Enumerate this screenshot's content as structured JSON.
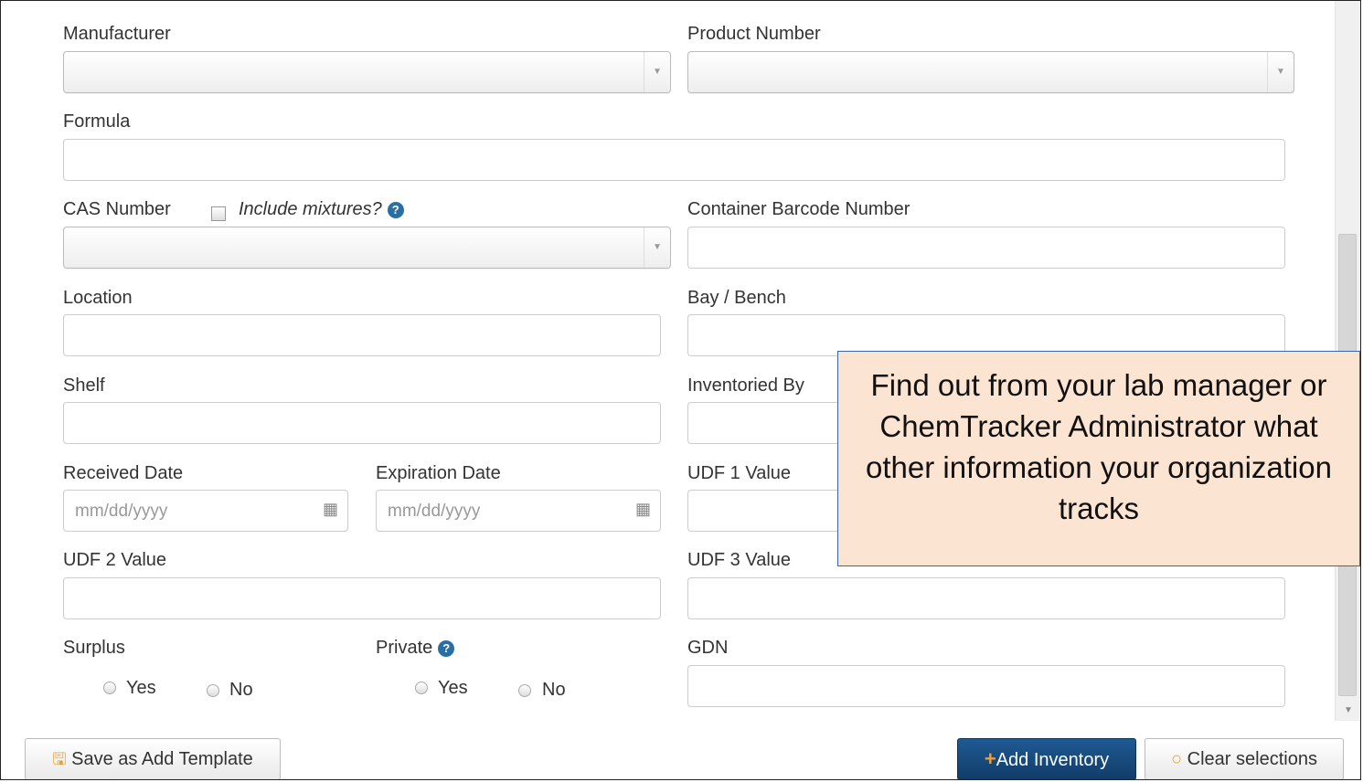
{
  "form": {
    "manufacturer": {
      "label": "Manufacturer",
      "value": ""
    },
    "product_number": {
      "label": "Product Number",
      "value": ""
    },
    "formula": {
      "label": "Formula",
      "value": ""
    },
    "cas_number": {
      "label": "CAS Number",
      "include_mixtures_label": "Include mixtures?",
      "include_mixtures_checked": false,
      "value": ""
    },
    "container_barcode": {
      "label": "Container Barcode Number",
      "value": ""
    },
    "location": {
      "label": "Location",
      "value": ""
    },
    "bay_bench": {
      "label": "Bay / Bench",
      "value": ""
    },
    "shelf": {
      "label": "Shelf",
      "value": ""
    },
    "inventoried_by": {
      "label": "Inventoried By",
      "value": ""
    },
    "received_date": {
      "label": "Received Date",
      "placeholder": "mm/dd/yyyy"
    },
    "expiration_date": {
      "label": "Expiration Date",
      "placeholder": "mm/dd/yyyy"
    },
    "udf1": {
      "label": "UDF 1 Value",
      "value": ""
    },
    "udf2": {
      "label": "UDF 2 Value",
      "value": ""
    },
    "udf3": {
      "label": "UDF 3 Value",
      "value": ""
    },
    "surplus": {
      "label": "Surplus",
      "options": [
        "Yes",
        "No"
      ],
      "selected": null
    },
    "private": {
      "label": "Private",
      "options": [
        "Yes",
        "No"
      ],
      "selected": null
    },
    "gdn": {
      "label": "GDN",
      "value": ""
    }
  },
  "buttons": {
    "save_template": "Save as Add Template",
    "add_inventory": "Add Inventory",
    "clear_selections": "Clear selections"
  },
  "callout": {
    "text": "Find out from your lab manager or ChemTracker Administrator what other information your organization tracks",
    "background": "#fce4d2",
    "border": "#3a67a8"
  },
  "colors": {
    "primary_button": "#113c69",
    "plus_icon": "#f0a030",
    "help_icon": "#2a6fa3"
  },
  "icons": {
    "save": "floppy-disk-icon",
    "add": "plus-icon",
    "clear": "circle-outline-icon",
    "help": "question-circle-icon",
    "calendar": "calendar-icon",
    "dropdown": "caret-down-icon"
  }
}
